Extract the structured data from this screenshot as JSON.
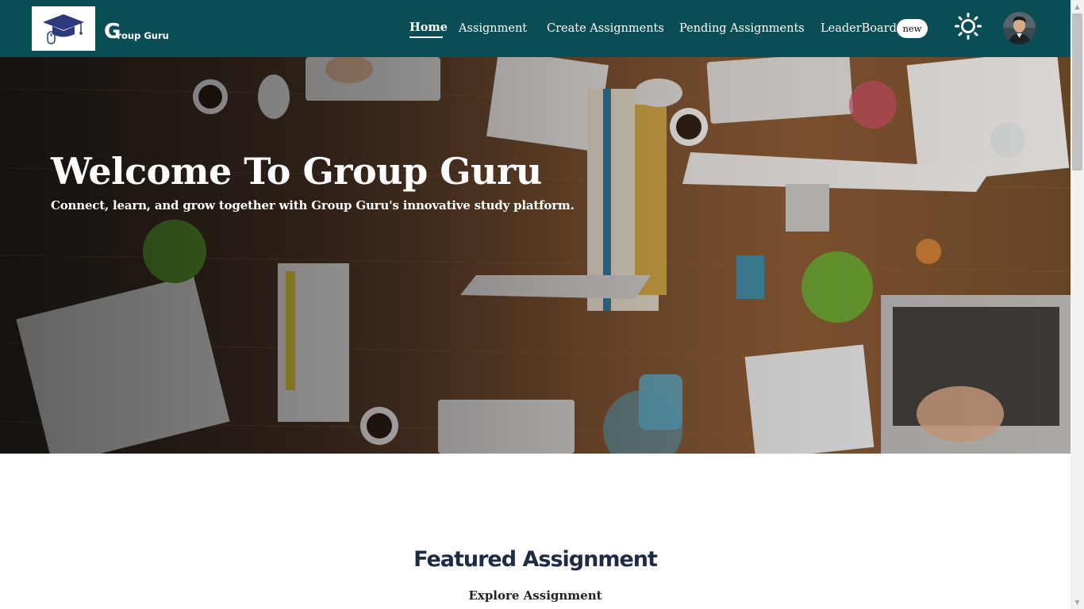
{
  "brand": {
    "mark": "G",
    "name": "roup Guru"
  },
  "nav": {
    "items": [
      {
        "label": "Home",
        "active": true
      },
      {
        "label": "Assignment"
      },
      {
        "label": "Create Assignments"
      },
      {
        "label": "Pending Assignments"
      },
      {
        "label": "LeaderBoard"
      }
    ],
    "badge": "new"
  },
  "icons": {
    "logo": "graduation-cap-icon",
    "theme": "sun-icon",
    "avatar": "user-avatar"
  },
  "hero": {
    "title": "Welcome To Group Guru",
    "subtitle": "Connect, learn, and grow together with Group Guru's innovative study platform."
  },
  "featured": {
    "title": "Featured Assignment",
    "subtitle": "Explore Assignment"
  },
  "colors": {
    "navbar": "#0a4d55",
    "heading": "#1f2a44",
    "logo_cap": "#2d3a7c"
  }
}
